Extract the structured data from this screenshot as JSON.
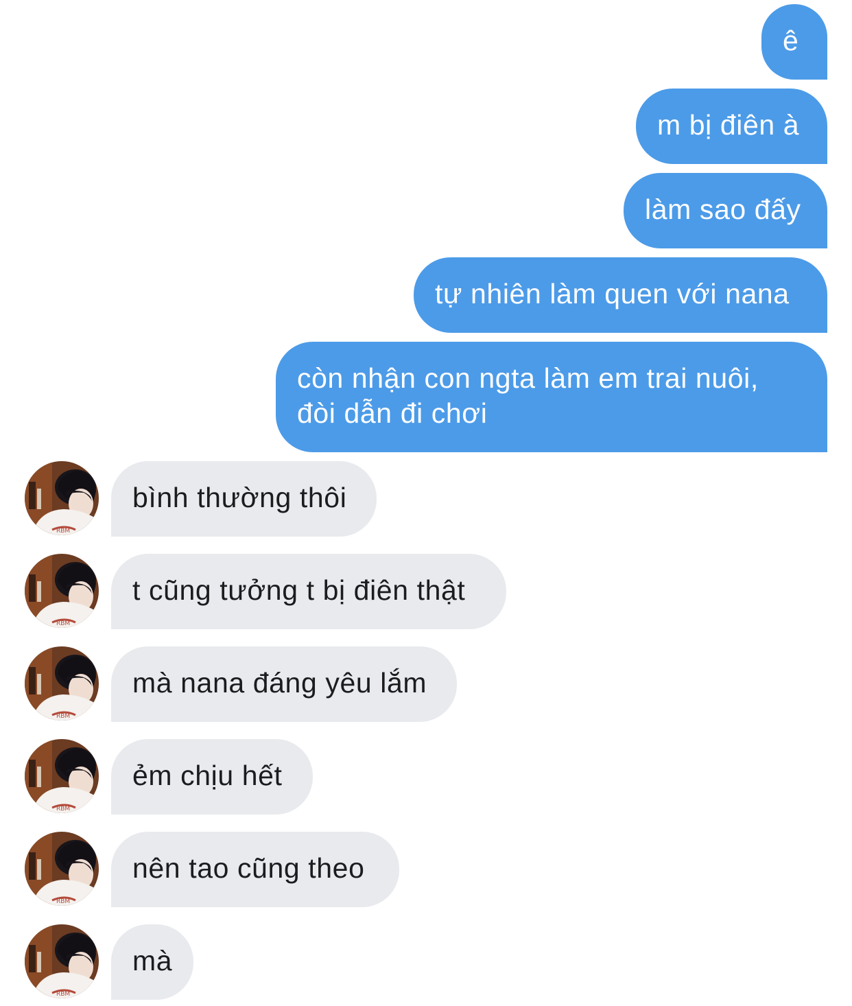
{
  "colors": {
    "outgoing_bubble": "#4c9be8",
    "incoming_bubble": "#e8eaed",
    "outgoing_text": "#ffffff",
    "incoming_text": "#1b1c1e",
    "background": "#ffffff"
  },
  "contact": {
    "avatar_icon": "contact-avatar-photo"
  },
  "messages": {
    "outgoing": [
      {
        "text": "ê"
      },
      {
        "text": "m bị điên à"
      },
      {
        "text": "làm sao đấy"
      },
      {
        "text": "tự nhiên làm quen với nana"
      },
      {
        "text": "còn nhận con ngta làm em trai nuôi, đòi dẫn đi chơi"
      }
    ],
    "incoming": [
      {
        "text": "bình thường thôi"
      },
      {
        "text": "t cũng tưởng t bị điên thật"
      },
      {
        "text": "mà nana đáng yêu lắm"
      },
      {
        "text": "ẻm chịu hết"
      },
      {
        "text": "nên tao cũng theo"
      },
      {
        "text": "mà"
      }
    ]
  }
}
